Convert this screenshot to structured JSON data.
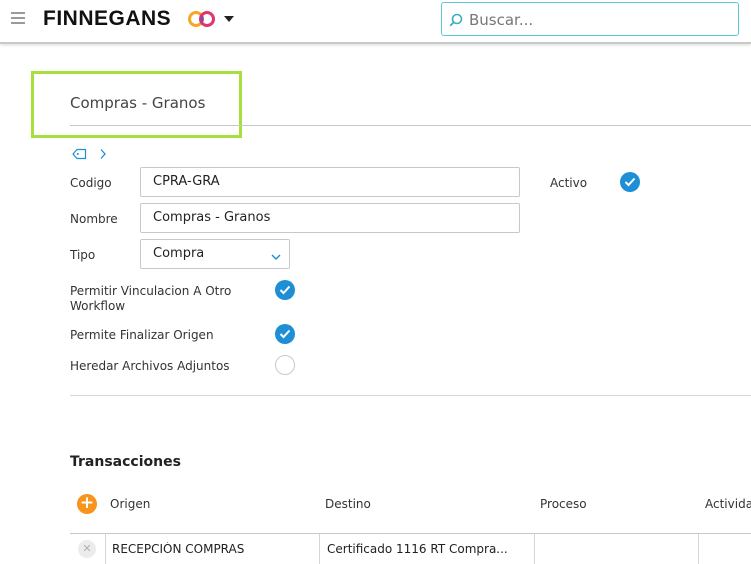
{
  "header": {
    "brand": "FINNEGANS",
    "search_placeholder": "Buscar..."
  },
  "page": {
    "title": "Compras - Granos"
  },
  "form": {
    "codigo_label": "Codigo",
    "codigo_value": "CPRA-GRA",
    "activo_label": "Activo",
    "activo_checked": true,
    "nombre_label": "Nombre",
    "nombre_value": "Compras - Granos",
    "tipo_label": "Tipo",
    "tipo_value": "Compra",
    "vinculacion_label_line1": "Permitir Vinculacion A Otro",
    "vinculacion_label_line2": "Workflow",
    "vinculacion_checked": true,
    "finalizar_label": "Permite Finalizar Origen",
    "finalizar_checked": true,
    "heredar_label": "Heredar Archivos Adjuntos",
    "heredar_checked": false
  },
  "transacciones": {
    "title": "Transacciones",
    "columns": [
      "Origen",
      "Destino",
      "Proceso",
      "Activida"
    ],
    "rows": [
      {
        "origen": "RECEPCIÓN COMPRAS",
        "destino": "Certificado 1116 RT Compra...",
        "proceso": "",
        "actividad": ""
      }
    ]
  },
  "colors": {
    "accent_blue": "#1e8fd6",
    "add_orange": "#f7941d",
    "search_border": "#5bc8d6",
    "highlight_green": "#a7df3d"
  }
}
